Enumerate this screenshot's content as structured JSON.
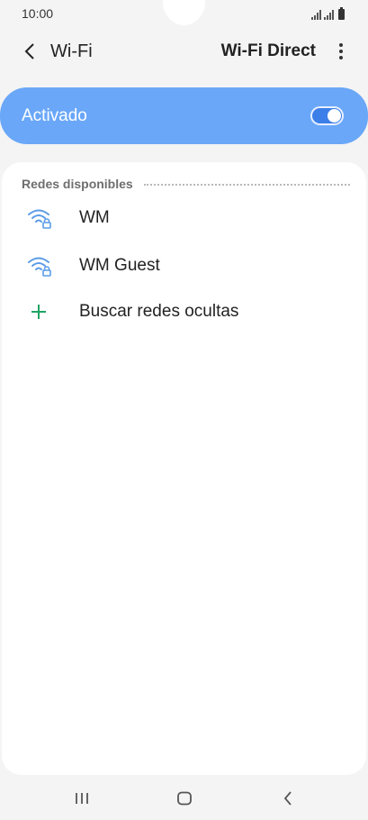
{
  "status_bar": {
    "time": "10:00"
  },
  "header": {
    "title": "Wi-Fi",
    "action_label": "Wi-Fi Direct"
  },
  "master_switch": {
    "label": "Activado",
    "state": "on",
    "color": "#6aa7f8"
  },
  "networks": {
    "section_title": "Redes disponibles",
    "items": [
      {
        "name": "WM",
        "icon": "wifi-lock-icon"
      },
      {
        "name": "WM Guest",
        "icon": "wifi-lock-icon"
      }
    ],
    "add_hidden": {
      "label": "Buscar redes ocultas",
      "icon": "plus-icon"
    }
  },
  "colors": {
    "accent": "#3d7fe8",
    "wifi_icon": "#5a9be8",
    "plus_icon": "#1ea365"
  }
}
